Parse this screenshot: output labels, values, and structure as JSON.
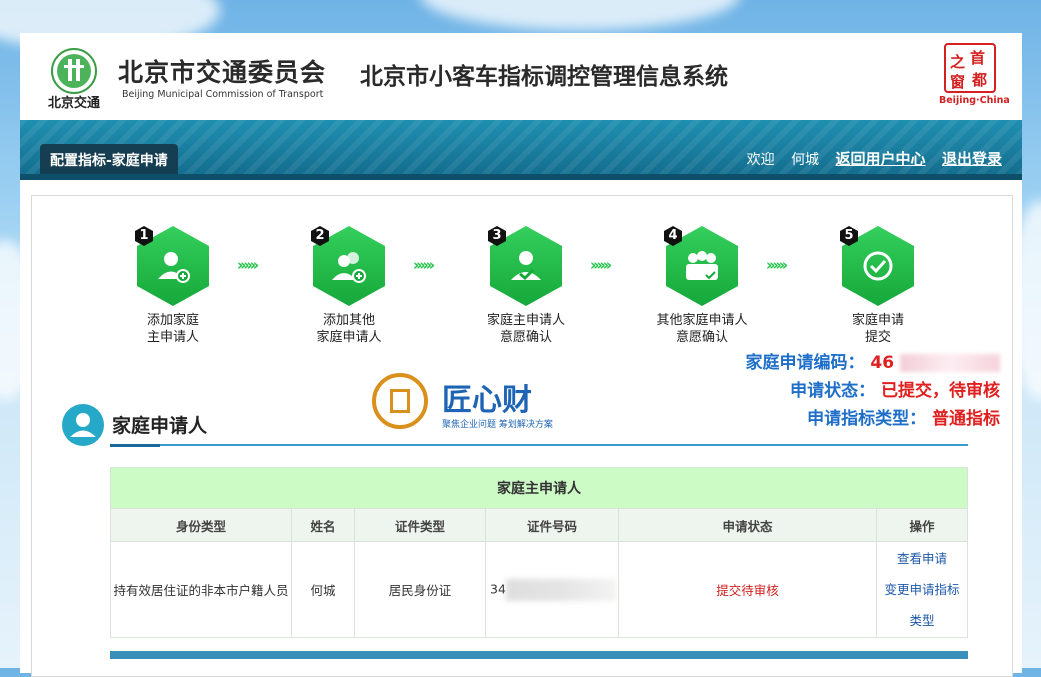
{
  "header": {
    "org_cn": "北京市交通委员会",
    "org_en": "Beijing Municipal Commission of Transport",
    "logo_text": "北京交通",
    "system_title": "北京市小客车指标调控管理信息系统",
    "seal_chars": [
      "首",
      "之",
      "都",
      "窗"
    ],
    "seal_en": "Beijing·China"
  },
  "nav": {
    "active_tab": "配置指标-家庭申请",
    "welcome": "欢迎",
    "username": "何城",
    "return_link": "返回用户中心",
    "logout_link": "退出登录"
  },
  "steps": [
    {
      "num": "1",
      "label": "添加家庭\n主申请人",
      "icon": "add-user-icon"
    },
    {
      "num": "2",
      "label": "添加其他\n家庭申请人",
      "icon": "add-users-icon"
    },
    {
      "num": "3",
      "label": "家庭主申请人\n意愿确认",
      "icon": "user-check-icon"
    },
    {
      "num": "4",
      "label": "其他家庭申请人\n意愿确认",
      "icon": "group-check-icon"
    },
    {
      "num": "5",
      "label": "家庭申请\n提交",
      "icon": "check-circle-icon"
    }
  ],
  "step_arrow": "››››››",
  "info": {
    "code_label": "家庭申请编码：",
    "code_value": "46",
    "status_label": "申请状态：",
    "status_value": "已提交，待审核",
    "type_label": "申请指标类型：",
    "type_value": "普通指标"
  },
  "watermark": {
    "title": "匠心财",
    "subtitle": "聚焦企业问题  筹划解决方案"
  },
  "section": {
    "title": "家庭申请人"
  },
  "table": {
    "caption": "家庭主申请人",
    "headers": [
      "身份类型",
      "姓名",
      "证件类型",
      "证件号码",
      "申请状态",
      "操作"
    ],
    "row": {
      "identity": "持有效居住证的非本市户籍人员",
      "name": "何城",
      "id_type": "居民身份证",
      "id_prefix": "34",
      "status": "提交待审核",
      "op_view": "查看申请",
      "op_change_1": "变更申请指标",
      "op_change_2": "类型"
    }
  },
  "colors": {
    "accent_green": "#16a83a",
    "nav_blue": "#1a7fa1",
    "status_red": "#e02020",
    "label_blue": "#1f6fc9"
  }
}
